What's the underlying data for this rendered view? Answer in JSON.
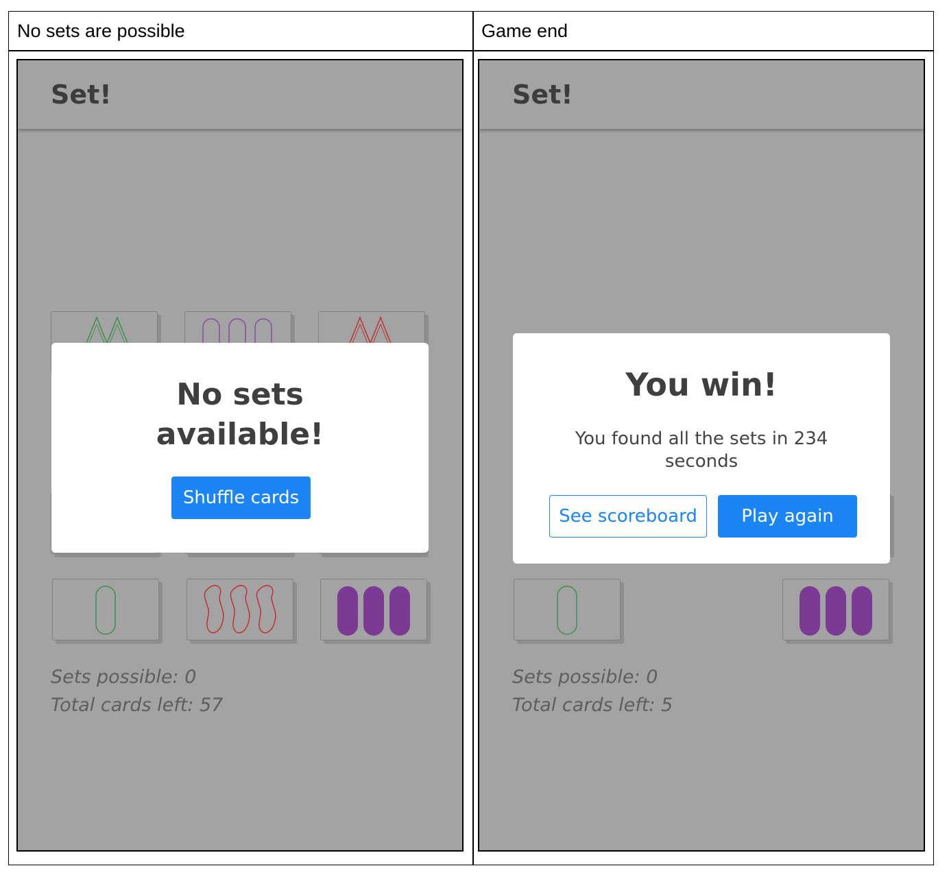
{
  "columns": [
    {
      "header": "No sets are possible"
    },
    {
      "header": "Game end"
    }
  ],
  "left_screen": {
    "app_title": "Set!",
    "modal": {
      "title_line1": "No sets",
      "title_line2": "available!",
      "button": "Shuffle cards"
    },
    "stats": {
      "sets_possible": "Sets possible: 0",
      "cards_left": "Total cards left: 57"
    }
  },
  "right_screen": {
    "app_title": "Set!",
    "modal": {
      "title": "You win!",
      "message_line1": "You found all the sets in 234",
      "message_line2": "seconds",
      "secondary_button": "See scoreboard",
      "primary_button": "Play again"
    },
    "stats": {
      "sets_possible": "Sets possible: 0",
      "cards_left": "Total cards left: 5"
    }
  },
  "colors": {
    "overlay_gray": "#a3a3a3",
    "accent_blue": "#1b85f5",
    "card_green": "#3f8f4a",
    "card_purple": "#7b3a93",
    "card_red": "#c03030"
  }
}
